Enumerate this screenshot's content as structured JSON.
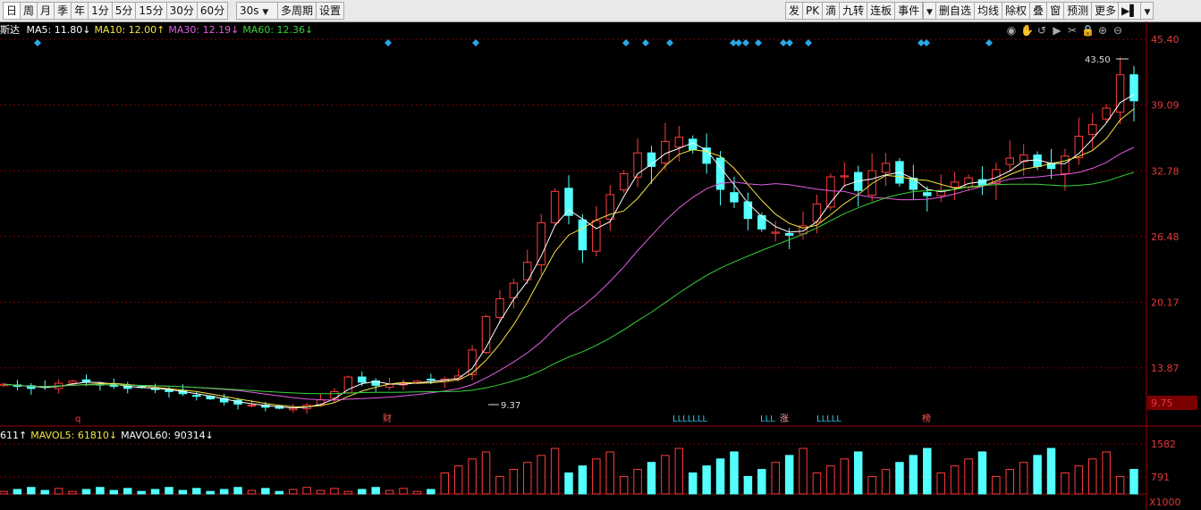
{
  "toolbar": {
    "left": [
      "日",
      "周",
      "月",
      "季",
      "年",
      "1分",
      "5分",
      "15分",
      "30分",
      "60分"
    ],
    "period_select": "30s",
    "left2": [
      "多周期",
      "设置"
    ],
    "right": [
      "发",
      "PK",
      "滴",
      "九转",
      "连板",
      "事件"
    ],
    "right2": [
      "删自选",
      "均线",
      "除权",
      "叠",
      "窗",
      "预测",
      "更多"
    ]
  },
  "ma_line": {
    "name": "斯达",
    "items": [
      {
        "label": "MA5: 11.80",
        "arrow": "↓",
        "color": "#ffffff"
      },
      {
        "label": "MA10: 12.00",
        "arrow": "↑",
        "color": "#f4e542"
      },
      {
        "label": "MA30: 12.19",
        "arrow": "↓",
        "color": "#e35ce3"
      },
      {
        "label": "MA60: 12.36",
        "arrow": "↓",
        "color": "#35d335"
      }
    ]
  },
  "vol_line": {
    "items": [
      {
        "label": "611",
        "arrow": "↑",
        "color": "#ffffff"
      },
      {
        "label": "MAVOL5: 61810",
        "arrow": "↓",
        "color": "#f4e542"
      },
      {
        "label": "MAVOL60: 90314",
        "arrow": "↓",
        "color": "#ffffff"
      }
    ]
  },
  "icons": [
    "eye-icon",
    "hand-icon",
    "replay-icon",
    "play-icon",
    "scissors-icon",
    "lock-icon",
    "zoom-in-icon",
    "zoom-out-icon"
  ],
  "axis_labels": [
    "45.40",
    "39.09",
    "32.78",
    "26.48",
    "20.17",
    "13.87"
  ],
  "current_price_tag": "9.75",
  "vol_axis_labels": [
    "1582",
    "791"
  ],
  "vol_unit": "X1000",
  "annotations": {
    "high_label": "43.50",
    "low_label": "9.37",
    "markers": [
      {
        "text": "q",
        "color": "#ff3b3b"
      },
      {
        "text": "财",
        "color": "#ff5555"
      },
      {
        "text": "LLLLLLL",
        "color": "#29c6e8"
      },
      {
        "text": "LLL",
        "color": "#29c6e8"
      },
      {
        "text": "涨",
        "color": "#ff9999"
      },
      {
        "text": "LLLLL",
        "color": "#29c6e8"
      },
      {
        "text": "榜",
        "color": "#ff5555"
      }
    ]
  },
  "colors": {
    "up": "#ff3b3b",
    "down": "#54ffff",
    "grid": "#7a0000",
    "ma5": "#ffffff",
    "ma10": "#f4e542",
    "ma30": "#e35ce3",
    "ma60": "#35d335"
  },
  "chart_data": {
    "type": "candlestick",
    "y_range": [
      9.75,
      45.4
    ],
    "high": 43.5,
    "low": 9.37,
    "close_series": [
      12.3,
      12.1,
      11.9,
      12.0,
      12.4,
      12.6,
      12.5,
      12.3,
      12.1,
      11.9,
      12.0,
      11.8,
      11.6,
      11.4,
      11.2,
      10.9,
      10.6,
      10.4,
      10.3,
      10.1,
      10.0,
      10.0,
      10.3,
      10.8,
      11.6,
      13.0,
      12.5,
      12.2,
      12.3,
      12.4,
      12.6,
      12.7,
      12.8,
      13.1,
      15.6,
      18.8,
      20.5,
      22.0,
      24.0,
      27.8,
      30.8,
      28.5,
      25.2,
      28.0,
      30.5,
      32.5,
      34.5,
      33.2,
      35.6,
      36.0,
      34.8,
      33.5,
      31.0,
      29.8,
      28.2,
      27.2,
      26.9,
      26.6,
      27.5,
      29.6,
      32.2,
      32.3,
      30.9,
      32.8,
      33.5,
      31.6,
      31.0,
      30.4,
      30.9,
      31.7,
      32.1,
      31.4,
      32.9,
      34.0,
      34.3,
      33.2,
      33.0,
      34.2,
      36.1,
      37.2,
      38.8,
      42.0,
      39.5
    ]
  }
}
